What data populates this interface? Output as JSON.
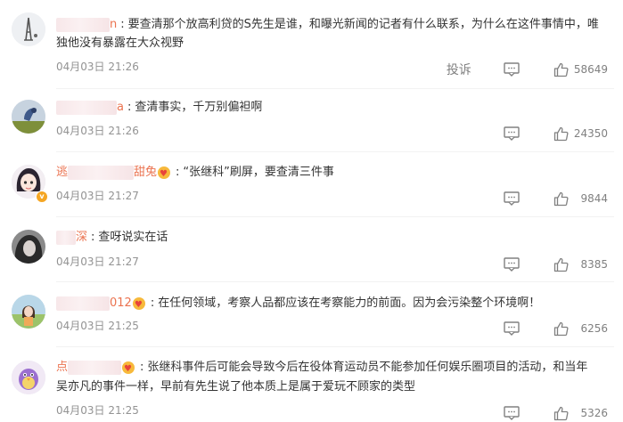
{
  "comments": [
    {
      "name_visible": "n",
      "text": "要查清那个放高利贷的S先生是谁，和曝光新闻的记者有什么联系，为什么在这件事情中，唯",
      "text2": "独他没有暴露在大众视野",
      "time": "04月03日 21:26",
      "report": "投诉",
      "likes": "58649"
    },
    {
      "name_visible": "a",
      "text": "查清事实，千万别偏袒啊",
      "time": "04月03日 21:26",
      "likes": "24350"
    },
    {
      "name_prefix": "逃",
      "name_visible": "甜兔",
      "text": "“张继科”刷屏，要查清三件事",
      "time": "04月03日 21:27",
      "likes": "9844"
    },
    {
      "name_visible": "深",
      "text": "查呀说实在话",
      "time": "04月03日 21:27",
      "likes": "8385"
    },
    {
      "name_visible": "012",
      "text": "在任何领域，考察人品都应该在考察能力的前面。因为会污染整个环境啊！",
      "time": "04月03日 21:25",
      "likes": "6256"
    },
    {
      "name_prefix": "点",
      "text": "张继科事件后可能会导致今后在役体育运动员不能参加任何娱乐圈项目的活动，和当年",
      "text2": "吴亦凡的事件一样，早前有先生说了他本质上是属于爱玩不顾家的类型",
      "time": "04月03日 21:25",
      "likes": "5326"
    }
  ],
  "colors": {
    "name": "#eb7350",
    "time": "#939393",
    "icon": "#808080"
  }
}
